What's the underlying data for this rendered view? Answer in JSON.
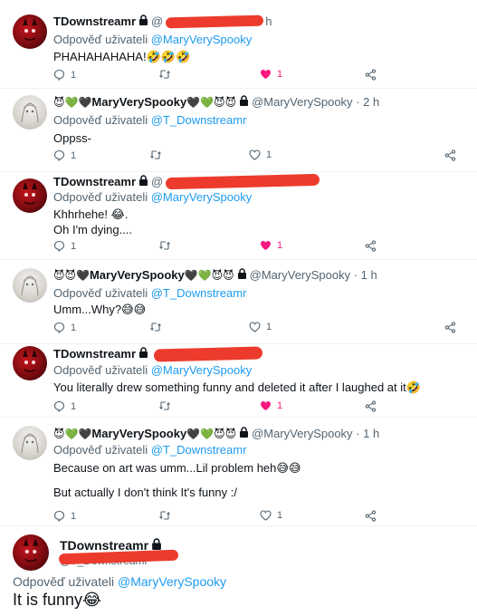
{
  "labels": {
    "reply_prefix": "Odpověď uživateli",
    "mention": "@MaryVerySpooky",
    "mention_t": "@T_Downstreamr"
  },
  "tweets": [
    {
      "author": "TDownstreamr",
      "handle": "@",
      "time": "h",
      "reply_to": "@MaryVerySpooky",
      "text_lines": [
        "PHAHAHAHAHA!🤣🤣🤣"
      ],
      "replies": "1",
      "retweets": "",
      "likes": "1",
      "liked": true,
      "avatar": "red-demon-avatar"
    },
    {
      "author_prefix": "😈💚🖤",
      "author": "MaryVerySpooky",
      "author_suffix": "🖤💚😈😈",
      "handle": "@MaryVerySpooky · 2 h",
      "reply_to": "@T_Downstreamr",
      "text_lines": [
        "Oppss-"
      ],
      "replies": "1",
      "retweets": "",
      "likes": "1",
      "liked": false,
      "avatar": "gray-sketch-avatar"
    },
    {
      "author": "TDownstreamr",
      "handle": "@",
      "reply_to": "@MaryVerySpooky",
      "text_lines": [
        "Khhrhehe! 😂.",
        "Oh I'm dying...."
      ],
      "replies": "1",
      "retweets": "",
      "likes": "1",
      "liked": true,
      "avatar": "red-demon-avatar"
    },
    {
      "author_prefix": "😈😈🖤",
      "author": "MaryVerySpooky",
      "author_suffix": "🖤💚😈😈",
      "handle": "@MaryVerySpooky · 1 h",
      "reply_to": "@T_Downstreamr",
      "text_lines": [
        "Umm...Why?😅😅"
      ],
      "replies": "1",
      "retweets": "",
      "likes": "1",
      "liked": false,
      "avatar": "gray-sketch-avatar"
    },
    {
      "author": "TDownstreamr",
      "handle": "@",
      "reply_to": "@MaryVerySpooky",
      "text_lines": [
        "You literally drew something funny and deleted it after I laughed at it🤣"
      ],
      "replies": "1",
      "retweets": "",
      "likes": "1",
      "liked": true,
      "avatar": "red-demon-avatar"
    },
    {
      "author_prefix": "😈💚🖤",
      "author": "MaryVerySpooky",
      "author_suffix": "🖤💚😈😈",
      "handle": "@MaryVerySpooky · 1 h",
      "reply_to": "@T_Downstreamr",
      "text_lines": [
        "Because on art was umm...Lil problem heh😅😅",
        "",
        "But actually I don't think It's funny :/"
      ],
      "replies": "1",
      "retweets": "",
      "likes": "1",
      "liked": false,
      "avatar": "gray-sketch-avatar"
    }
  ],
  "main_tweet": {
    "author": "TDownstreamr",
    "handle": "@T_Downstreamr",
    "reply_prefix": "Odpověď uživateli",
    "reply_to": "@MaryVerySpooky",
    "text": "It is funny😂"
  },
  "colors": {
    "accent": "#1d9bf0",
    "like": "#f91880",
    "muted": "#536471",
    "redaction": "#ec3b2c"
  }
}
